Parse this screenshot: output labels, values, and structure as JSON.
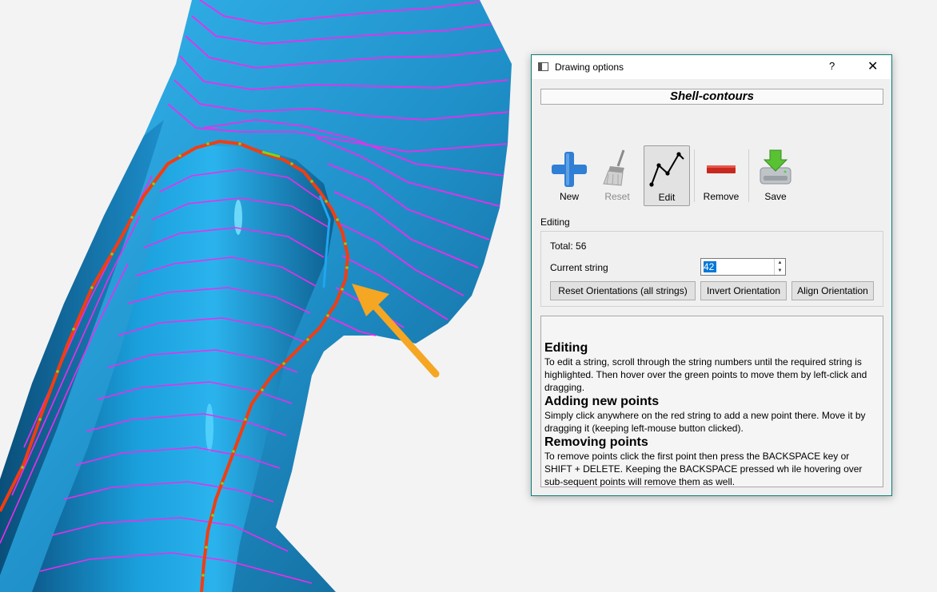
{
  "dialog": {
    "title": "Drawing options",
    "help_glyph": "?",
    "close_glyph": "✕",
    "header": "Shell-contours"
  },
  "toolbar": {
    "new_label": "New",
    "reset_label": "Reset",
    "edit_label": "Edit",
    "remove_label": "Remove",
    "save_label": "Save"
  },
  "editing": {
    "group_label": "Editing",
    "total_text": "Total: 56",
    "current_string_label": "Current string",
    "current_string_value": "42",
    "reset_orientations_label": "Reset Orientations (all strings)",
    "invert_orientation_label": "Invert Orientation",
    "align_orientation_label": "Align Orientation"
  },
  "help": {
    "editing_heading": "Editing",
    "editing_text": "To edit a string, scroll through the string numbers until the required string is highlighted. Then hover over the green points to move them by left-click and dragging.",
    "adding_heading": "Adding new points",
    "adding_text": "Simply click anywhere on the red string to add a new point there. Move it by dragging it (keeping left-mouse button clicked).",
    "removing_heading": "Removing points",
    "removing_text": "To  remove points click the first point then press the BACKSPACE key or SHIFT + DELETE. Keeping the BACKSPACE pressed wh ile hovering over sub-sequent points will remove them as well."
  },
  "icons": {
    "window": "window-icon",
    "new": "plus-icon",
    "reset": "broom-icon",
    "edit": "polyline-icon",
    "remove": "minus-icon",
    "save": "disk-download-icon"
  },
  "colors": {
    "surface_light": "#35b8f0",
    "surface_dark": "#0a4f7a",
    "contour": "#ee2bee",
    "active_string": "#f23d11",
    "points": "#7ed321",
    "arrow": "#f5a623",
    "dialog_border": "#0b7c76"
  }
}
